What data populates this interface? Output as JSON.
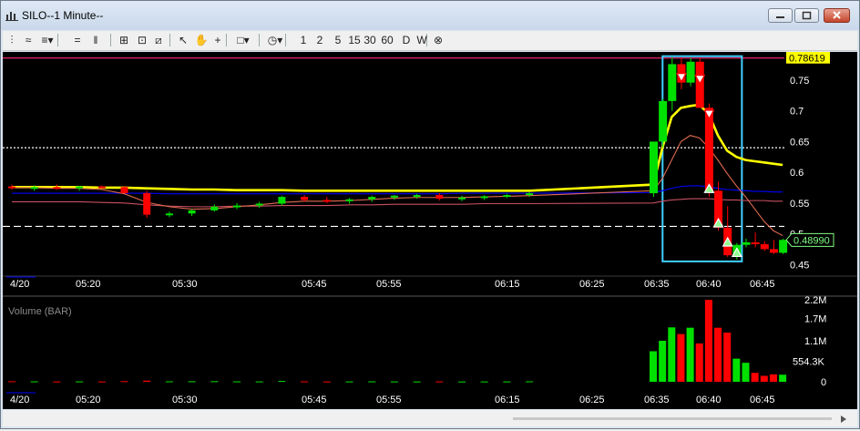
{
  "window": {
    "title": "SILO--1 Minute--",
    "controls": [
      "minimize",
      "maximize",
      "close"
    ]
  },
  "toolbar": {
    "buttons": [
      {
        "name": "chart-type-icon",
        "glyph": "⫶"
      },
      {
        "name": "line-style-icon",
        "glyph": "≈"
      },
      {
        "name": "studies-icon",
        "glyph": "≡▾"
      },
      {
        "name": "horizontal-lines-icon",
        "glyph": "="
      },
      {
        "name": "vertical-lines-icon",
        "glyph": "‖"
      },
      {
        "name": "crosshair-grid-icon",
        "glyph": "⊞"
      },
      {
        "name": "zoom-icon",
        "glyph": "⊡"
      },
      {
        "name": "fit-icon",
        "glyph": "⧄"
      },
      {
        "name": "cursor-icon",
        "glyph": "↖"
      },
      {
        "name": "hand-icon",
        "glyph": "✋"
      },
      {
        "name": "crosshair-icon",
        "glyph": "+"
      },
      {
        "name": "drawing-tool-icon",
        "glyph": "□▾"
      },
      {
        "name": "timeframe-clock-icon",
        "glyph": "◷▾"
      },
      {
        "name": "cancel-icon",
        "glyph": "⊗"
      }
    ],
    "intervals": [
      "1",
      "2",
      "5",
      "15",
      "30",
      "60",
      "D",
      "W"
    ]
  },
  "price_pane": {
    "y_ticks": [
      "0.75",
      "0.7",
      "0.65",
      "0.6",
      "0.55",
      "0.5",
      "0.45"
    ],
    "high_label": "0.78619",
    "last_label": "0.48990"
  },
  "volume_pane": {
    "title": "Volume (BAR)",
    "y_ticks": [
      "2.2M",
      "1.7M",
      "1.1M",
      "554.3K",
      "0"
    ]
  },
  "time_axis": {
    "date_label": "4/20",
    "ticks": [
      "05:20",
      "05:30",
      "05:45",
      "05:55",
      "06:15",
      "06:25",
      "06:35",
      "06:40",
      "06:45"
    ]
  },
  "colors": {
    "up": "#00e000",
    "down": "#ff0000",
    "ma_yellow": "#ffff00",
    "ma_blue": "#0000ff",
    "resistance": "#ff2a7a",
    "selection_box": "#40d0ff"
  },
  "chart_data": [
    {
      "type": "candlestick",
      "title": "",
      "ylim": [
        0.44,
        0.79
      ],
      "ytick_values": [
        0.75,
        0.7,
        0.65,
        0.6,
        0.55,
        0.5,
        0.45
      ],
      "candles": [
        {
          "o": 0.577,
          "h": 0.58,
          "l": 0.572,
          "c": 0.575
        },
        {
          "o": 0.575,
          "h": 0.579,
          "l": 0.57,
          "c": 0.576
        },
        {
          "o": 0.576,
          "h": 0.58,
          "l": 0.572,
          "c": 0.574
        },
        {
          "o": 0.574,
          "h": 0.578,
          "l": 0.57,
          "c": 0.577
        },
        {
          "o": 0.577,
          "h": 0.579,
          "l": 0.574,
          "c": 0.576
        },
        {
          "o": 0.576,
          "h": 0.578,
          "l": 0.568,
          "c": 0.566
        },
        {
          "o": 0.566,
          "h": 0.57,
          "l": 0.526,
          "c": 0.531
        },
        {
          "o": 0.531,
          "h": 0.536,
          "l": 0.527,
          "c": 0.533
        },
        {
          "o": 0.533,
          "h": 0.54,
          "l": 0.529,
          "c": 0.538
        },
        {
          "o": 0.538,
          "h": 0.548,
          "l": 0.536,
          "c": 0.544
        },
        {
          "o": 0.544,
          "h": 0.55,
          "l": 0.54,
          "c": 0.546
        },
        {
          "o": 0.546,
          "h": 0.552,
          "l": 0.542,
          "c": 0.549
        },
        {
          "o": 0.549,
          "h": 0.562,
          "l": 0.546,
          "c": 0.56
        },
        {
          "o": 0.56,
          "h": 0.563,
          "l": 0.552,
          "c": 0.555
        },
        {
          "o": 0.555,
          "h": 0.56,
          "l": 0.55,
          "c": 0.553
        },
        {
          "o": 0.553,
          "h": 0.558,
          "l": 0.549,
          "c": 0.556
        },
        {
          "o": 0.556,
          "h": 0.562,
          "l": 0.552,
          "c": 0.56
        },
        {
          "o": 0.56,
          "h": 0.563,
          "l": 0.555,
          "c": 0.562
        },
        {
          "o": 0.562,
          "h": 0.565,
          "l": 0.557,
          "c": 0.563
        },
        {
          "o": 0.563,
          "h": 0.566,
          "l": 0.554,
          "c": 0.557
        },
        {
          "o": 0.557,
          "h": 0.562,
          "l": 0.553,
          "c": 0.559
        },
        {
          "o": 0.559,
          "h": 0.563,
          "l": 0.555,
          "c": 0.561
        },
        {
          "o": 0.561,
          "h": 0.565,
          "l": 0.558,
          "c": 0.563
        },
        {
          "o": 0.563,
          "h": 0.568,
          "l": 0.56,
          "c": 0.566
        },
        {
          "o": 0.566,
          "h": 0.58,
          "l": 0.56,
          "c": 0.65
        },
        {
          "o": 0.65,
          "h": 0.72,
          "l": 0.64,
          "c": 0.716
        },
        {
          "o": 0.716,
          "h": 0.787,
          "l": 0.7,
          "c": 0.776
        },
        {
          "o": 0.776,
          "h": 0.786,
          "l": 0.735,
          "c": 0.746
        },
        {
          "o": 0.746,
          "h": 0.786,
          "l": 0.74,
          "c": 0.78
        },
        {
          "o": 0.78,
          "h": 0.786,
          "l": 0.705,
          "c": 0.705
        },
        {
          "o": 0.705,
          "h": 0.712,
          "l": 0.56,
          "c": 0.57
        },
        {
          "o": 0.57,
          "h": 0.585,
          "l": 0.505,
          "c": 0.51
        },
        {
          "o": 0.51,
          "h": 0.545,
          "l": 0.462,
          "c": 0.465
        },
        {
          "o": 0.465,
          "h": 0.485,
          "l": 0.458,
          "c": 0.482
        },
        {
          "o": 0.482,
          "h": 0.492,
          "l": 0.478,
          "c": 0.486
        },
        {
          "o": 0.486,
          "h": 0.502,
          "l": 0.478,
          "c": 0.483
        },
        {
          "o": 0.483,
          "h": 0.488,
          "l": 0.472,
          "c": 0.475
        },
        {
          "o": 0.475,
          "h": 0.49,
          "l": 0.467,
          "c": 0.469
        },
        {
          "o": 0.469,
          "h": 0.492,
          "l": 0.467,
          "c": 0.49
        }
      ],
      "moving_averages": [
        {
          "color": "#ffff00",
          "values": [
            0.576,
            0.576,
            0.576,
            0.576,
            0.575,
            0.575,
            0.574,
            0.573,
            0.572,
            0.572,
            0.571,
            0.571,
            0.571,
            0.57,
            0.57,
            0.57,
            0.57,
            0.57,
            0.57,
            0.57,
            0.57,
            0.57,
            0.57,
            0.57,
            0.58,
            0.64,
            0.69,
            0.705,
            0.708,
            0.71,
            0.695,
            0.66,
            0.635,
            0.625,
            0.62,
            0.618,
            0.616,
            0.614,
            0.612
          ]
        },
        {
          "color": "#0000ff",
          "values": [
            0.566,
            0.566,
            0.566,
            0.566,
            0.566,
            0.566,
            0.566,
            0.565,
            0.565,
            0.565,
            0.565,
            0.565,
            0.565,
            0.565,
            0.565,
            0.565,
            0.565,
            0.565,
            0.565,
            0.565,
            0.566,
            0.566,
            0.566,
            0.566,
            0.567,
            0.57,
            0.574,
            0.577,
            0.578,
            0.578,
            0.576,
            0.574,
            0.572,
            0.571,
            0.57,
            0.569,
            0.569,
            0.568,
            0.568
          ]
        },
        {
          "color": "#c85060",
          "values": [
            0.552,
            0.552,
            0.552,
            0.552,
            0.551,
            0.55,
            0.547,
            0.545,
            0.544,
            0.544,
            0.545,
            0.545,
            0.546,
            0.546,
            0.546,
            0.547,
            0.547,
            0.548,
            0.548,
            0.548,
            0.548,
            0.549,
            0.549,
            0.549,
            0.55,
            0.553,
            0.555,
            0.556,
            0.557,
            0.557,
            0.557,
            0.556,
            0.555,
            0.555,
            0.554,
            0.554,
            0.554,
            0.553,
            0.553
          ]
        },
        {
          "color": "#e06a50",
          "values": [
            0.575,
            0.575,
            0.574,
            0.574,
            0.572,
            0.565,
            0.551,
            0.544,
            0.54,
            0.541,
            0.544,
            0.547,
            0.551,
            0.553,
            0.553,
            0.554,
            0.556,
            0.558,
            0.559,
            0.559,
            0.559,
            0.56,
            0.561,
            0.562,
            0.57,
            0.59,
            0.62,
            0.65,
            0.66,
            0.656,
            0.64,
            0.62,
            0.598,
            0.578,
            0.56,
            0.54,
            0.52,
            0.505,
            0.497
          ]
        }
      ],
      "reference_lines": [
        {
          "value": 0.786,
          "style": "solid",
          "color": "#ff2a7a"
        },
        {
          "value": 0.64,
          "style": "dotted",
          "color": "#ffffff"
        },
        {
          "value": 0.512,
          "style": "dashed",
          "color": "#ffffff"
        }
      ],
      "markers": [
        {
          "bar": 27,
          "value": 0.755,
          "dir": "down"
        },
        {
          "bar": 29,
          "value": 0.752,
          "dir": "down"
        },
        {
          "bar": 30,
          "value": 0.695,
          "dir": "down"
        },
        {
          "bar": 30,
          "value": 0.573,
          "dir": "up"
        },
        {
          "bar": 31,
          "value": 0.517,
          "dir": "up"
        },
        {
          "bar": 32,
          "value": 0.486,
          "dir": "up"
        },
        {
          "bar": 33,
          "value": 0.469,
          "dir": "up"
        }
      ],
      "selection_box": {
        "bar_from": 26,
        "bar_to": 33,
        "top": 0.786,
        "bottom": 0.458
      }
    },
    {
      "type": "bar",
      "title": "Volume (BAR)",
      "ylim": [
        0,
        2200000
      ],
      "ytick_values": [
        2200000,
        1700000,
        1100000,
        554300,
        0
      ],
      "values": [
        15000,
        12000,
        10000,
        11000,
        9000,
        18000,
        30000,
        12000,
        14000,
        16000,
        11000,
        10000,
        22000,
        12000,
        9000,
        10000,
        12000,
        10000,
        9000,
        11000,
        8000,
        9000,
        10000,
        12000,
        820000,
        1100000,
        1460000,
        1280000,
        1450000,
        1030000,
        2200000,
        1450000,
        1320000,
        620000,
        510000,
        240000,
        160000,
        200000,
        190000
      ],
      "up": [
        false,
        true,
        false,
        true,
        false,
        false,
        false,
        true,
        true,
        true,
        true,
        true,
        true,
        false,
        false,
        true,
        true,
        true,
        true,
        false,
        true,
        true,
        true,
        true,
        true,
        true,
        true,
        false,
        true,
        false,
        false,
        false,
        false,
        true,
        true,
        false,
        false,
        false,
        true
      ]
    }
  ]
}
